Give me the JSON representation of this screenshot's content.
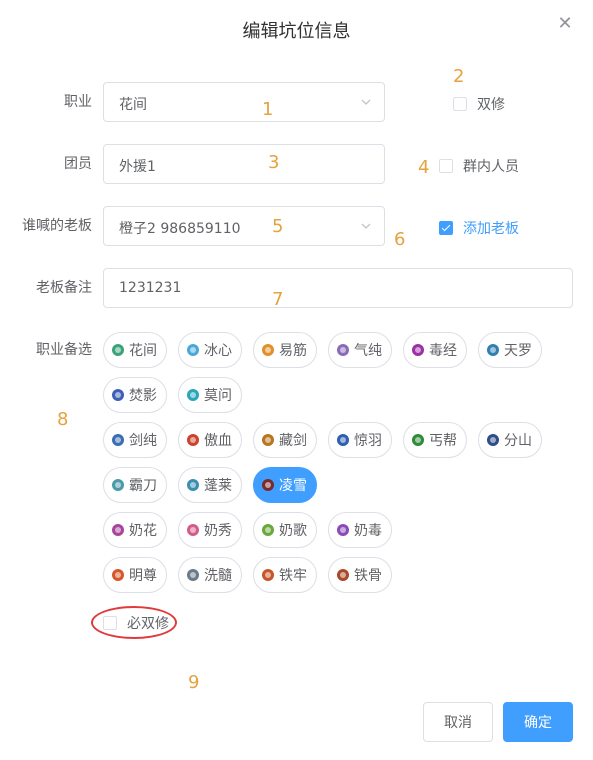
{
  "dialog": {
    "title": "编辑坑位信息"
  },
  "form": {
    "profession": {
      "label": "职业",
      "value": "花间"
    },
    "member": {
      "label": "团员",
      "value": "外援1"
    },
    "boss": {
      "label": "谁喊的老板",
      "value": "橙子2 986859110"
    },
    "boss_note": {
      "label": "老板备注",
      "value": "1231231"
    },
    "alt_profession": {
      "label": "职业备选"
    },
    "double_cultivation": {
      "label": "双修",
      "checked": false
    },
    "in_group": {
      "label": "群内人员",
      "checked": false
    },
    "add_boss": {
      "label": "添加老板",
      "checked": true
    },
    "must_double": {
      "label": "必双修",
      "checked": false
    }
  },
  "annotations": [
    "1",
    "2",
    "3",
    "4",
    "5",
    "6",
    "7",
    "8",
    "9"
  ],
  "chips": [
    {
      "label": "花间",
      "icon": "huajian-icon",
      "color": "#3aa37a",
      "selected": false
    },
    {
      "label": "冰心",
      "icon": "bingxin-icon",
      "color": "#4aa8d8",
      "selected": false
    },
    {
      "label": "易筋",
      "icon": "yijin-icon",
      "color": "#e0902a",
      "selected": false
    },
    {
      "label": "气纯",
      "icon": "qichun-icon",
      "color": "#8a6bb8",
      "selected": false
    },
    {
      "label": "毒经",
      "icon": "dujing-icon",
      "color": "#9b2fa5",
      "selected": false
    },
    {
      "label": "天罗",
      "icon": "tianluo-icon",
      "color": "#2f7fb0",
      "selected": false
    },
    {
      "label": "焚影",
      "icon": "fenying-icon",
      "color": "#3d5fb5",
      "selected": false
    },
    {
      "label": "莫问",
      "icon": "mowen-icon",
      "color": "#2aa6b8",
      "selected": false
    },
    {
      "label": "剑纯",
      "icon": "jianchun-icon",
      "color": "#3a6db3",
      "selected": false
    },
    {
      "label": "傲血",
      "icon": "aoxue-icon",
      "color": "#c9432e",
      "selected": false
    },
    {
      "label": "藏剑",
      "icon": "cangjian-icon",
      "color": "#b8741f",
      "selected": false
    },
    {
      "label": "惊羽",
      "icon": "jingyu-icon",
      "color": "#2f5fb0",
      "selected": false
    },
    {
      "label": "丐帮",
      "icon": "gaibang-icon",
      "color": "#2f8a3a",
      "selected": false
    },
    {
      "label": "分山",
      "icon": "fenshan-icon",
      "color": "#2e4d8a",
      "selected": false
    },
    {
      "label": "霸刀",
      "icon": "badao-icon",
      "color": "#4a9aa8",
      "selected": false
    },
    {
      "label": "蓬莱",
      "icon": "penglai-icon",
      "color": "#3a8fb0",
      "selected": false
    },
    {
      "label": "凌雪",
      "icon": "lingxue-icon",
      "color": "#7a2a2a",
      "selected": true
    },
    {
      "label": "奶花",
      "icon": "naihua-icon",
      "color": "#a8449a",
      "selected": false
    },
    {
      "label": "奶秀",
      "icon": "naixiu-icon",
      "color": "#d45c8a",
      "selected": false
    },
    {
      "label": "奶歌",
      "icon": "naige-icon",
      "color": "#6aa83a",
      "selected": false
    },
    {
      "label": "奶毒",
      "icon": "naidu-icon",
      "color": "#8a4ab8",
      "selected": false
    },
    {
      "label": "明尊",
      "icon": "mingzun-icon",
      "color": "#d4582a",
      "selected": false
    },
    {
      "label": "洗髓",
      "icon": "xisui-icon",
      "color": "#6a7a8a",
      "selected": false
    },
    {
      "label": "铁牢",
      "icon": "tielao-icon",
      "color": "#c4562a",
      "selected": false
    },
    {
      "label": "铁骨",
      "icon": "tiegu-icon",
      "color": "#a84a2a",
      "selected": false
    }
  ],
  "buttons": {
    "cancel": "取消",
    "confirm": "确定"
  },
  "colors": {
    "primary": "#409eff",
    "annotation": "#e6a23c",
    "highlight_circle": "#e03b3b"
  }
}
